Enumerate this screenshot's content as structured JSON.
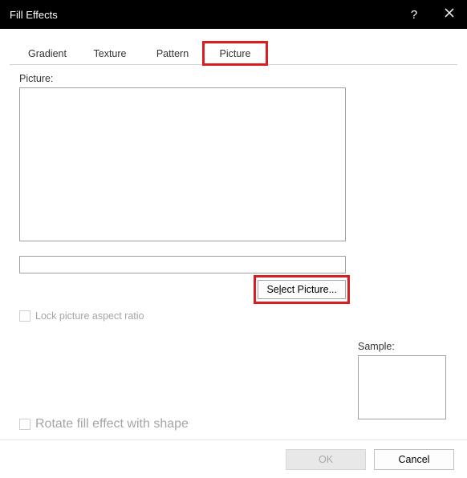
{
  "titlebar": {
    "title": "Fill Effects",
    "help": "?"
  },
  "tabs": {
    "items": [
      "Gradient",
      "Texture",
      "Pattern",
      "Picture"
    ],
    "activeIndex": 3
  },
  "body": {
    "pictureLabel": "Picture:",
    "selectPicture_prefix": "Se",
    "selectPicture_hotkey": "l",
    "selectPicture_suffix": "ect Picture...",
    "lockAspectLabel": "Lock picture aspect ratio",
    "sampleLabel": "Sample:",
    "rotateLabel": "Rotate fill effect with shape"
  },
  "footer": {
    "ok": "OK",
    "cancel": "Cancel"
  }
}
